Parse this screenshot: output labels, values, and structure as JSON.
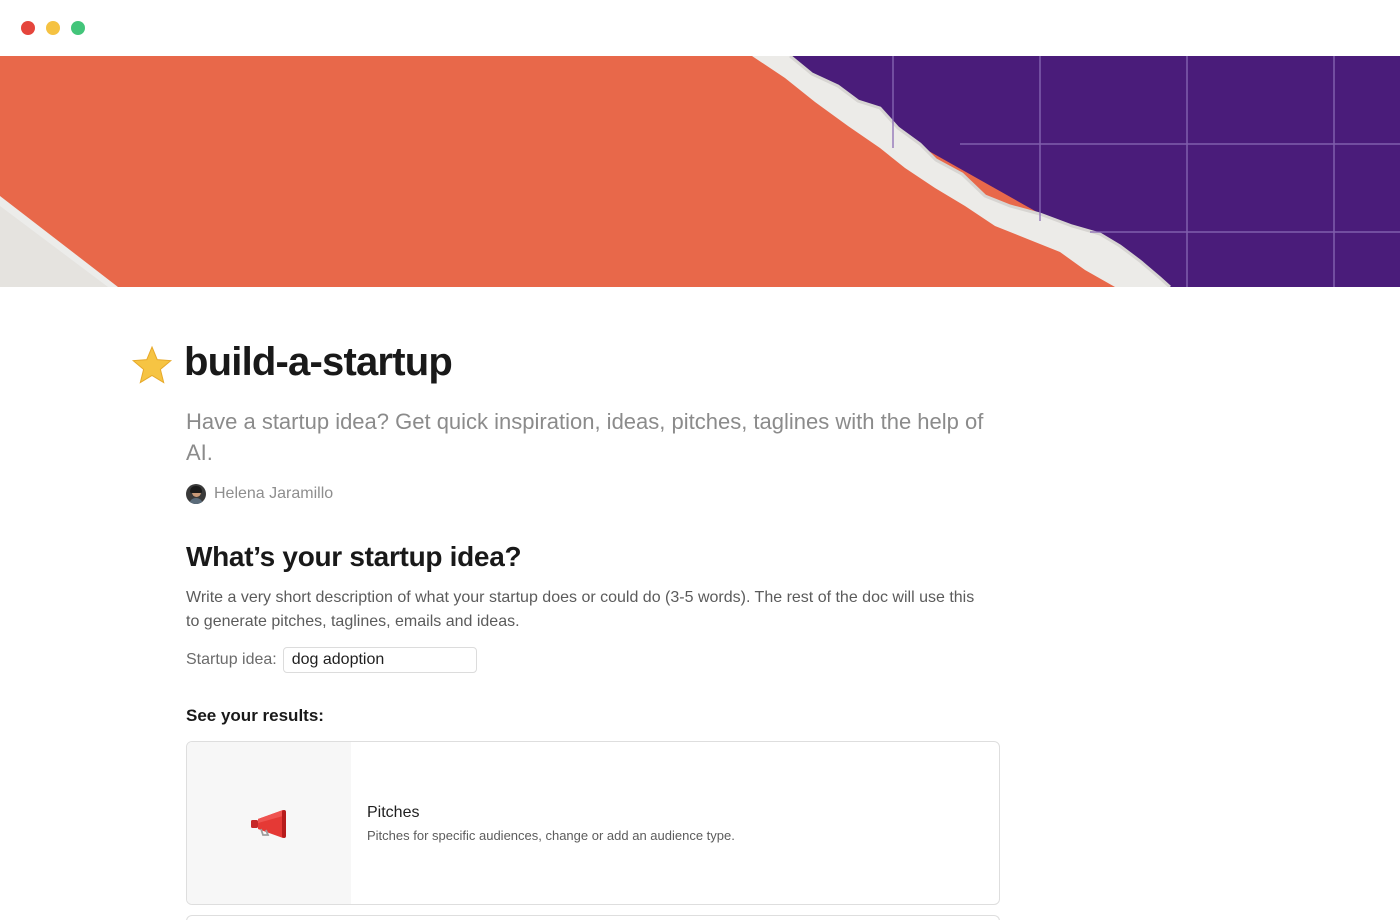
{
  "window": {
    "controls": [
      "close",
      "minimize",
      "zoom"
    ]
  },
  "page": {
    "icon": "star-icon",
    "title": "build-a-startup",
    "subtitle": "Have a startup idea? Get quick inspiration, ideas, pitches, taglines with the help of AI.",
    "author": "Helena Jaramillo"
  },
  "section": {
    "heading": "What’s your startup idea?",
    "description": "Write a very short description of what your startup does or could do (3-5 words). The rest of the doc will use this to generate pitches, taglines, emails and ideas.",
    "input_label": "Startup idea:",
    "input_value": "dog adoption"
  },
  "results": {
    "heading": "See your results:",
    "cards": [
      {
        "icon": "megaphone-icon",
        "title": "Pitches",
        "description": "Pitches for specific audiences, change or add an audience type."
      }
    ]
  },
  "colors": {
    "cover_orange": "#e8684a",
    "cover_purple": "#4a1c7a",
    "star": "#f6c443",
    "megaphone": "#e53935"
  }
}
